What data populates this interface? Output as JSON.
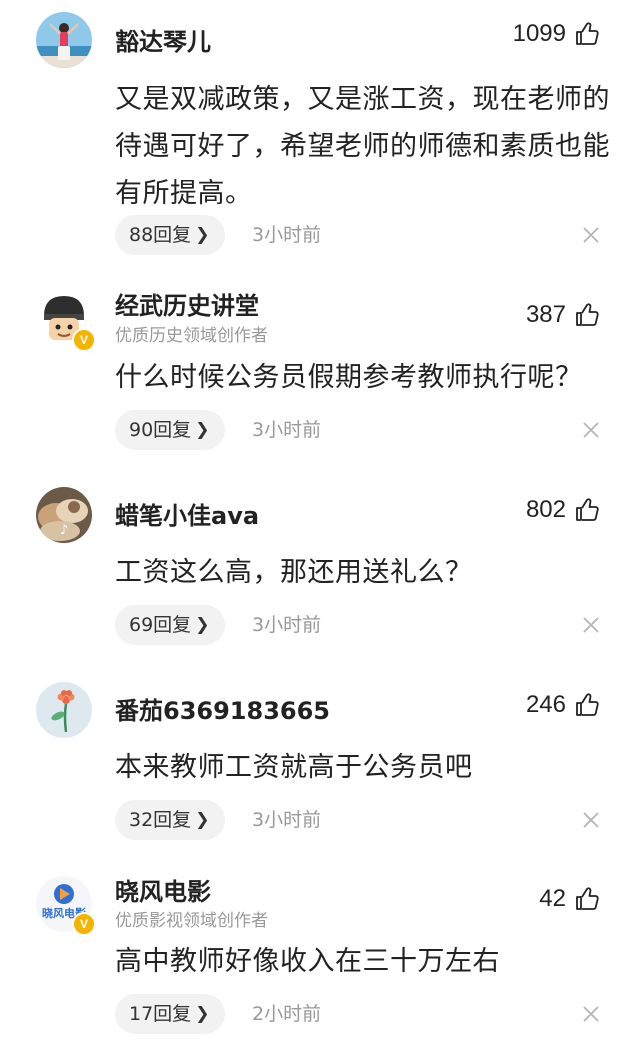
{
  "comments": [
    {
      "username": "豁达琴儿",
      "subtitle": "",
      "likes": "1099",
      "content": "又是双减政策，又是涨工资，现在老师的待遇可好了，希望老师的师德和素质也能有所提高。",
      "replies": "88回复",
      "time": "3小时前",
      "avatar_icon": "photo-avatar-woman-seaside"
    },
    {
      "username": "经武历史讲堂",
      "subtitle": "优质历史领域创作者",
      "likes": "387",
      "content": "什么时候公务员假期参考教师执行呢？",
      "replies": "90回复",
      "time": "3小时前",
      "avatar_icon": "cartoon-avatar-helmet",
      "verified_badge": "V"
    },
    {
      "username": "蜡笔小佳ava",
      "subtitle": "",
      "likes": "802",
      "content": "工资这么高，那还用送礼么？",
      "replies": "69回复",
      "time": "3小时前",
      "avatar_icon": "photo-avatar-cat",
      "badge_icon": "tiktok-icon"
    },
    {
      "username": "番茄6369183665",
      "subtitle": "",
      "likes": "246",
      "content": "本来教师工资就高于公务员吧",
      "replies": "32回复",
      "time": "3小时前",
      "avatar_icon": "default-avatar-flower"
    },
    {
      "username": "晓风电影",
      "subtitle": "优质影视领域创作者",
      "likes": "42",
      "content": "高中教师好像收入在三十万左右",
      "replies": "17回复",
      "time": "2小时前",
      "avatar_icon": "logo-avatar-film",
      "avatar_text": "晓风电影",
      "verified_badge": "V"
    }
  ],
  "icons": {
    "like": "thumbs-up-icon",
    "close": "close-icon",
    "chevron": "chevron-right-icon"
  },
  "colors": {
    "text": "#222222",
    "muted": "#999999",
    "pill_bg": "#f2f2f2",
    "verified": "#f5b400"
  }
}
